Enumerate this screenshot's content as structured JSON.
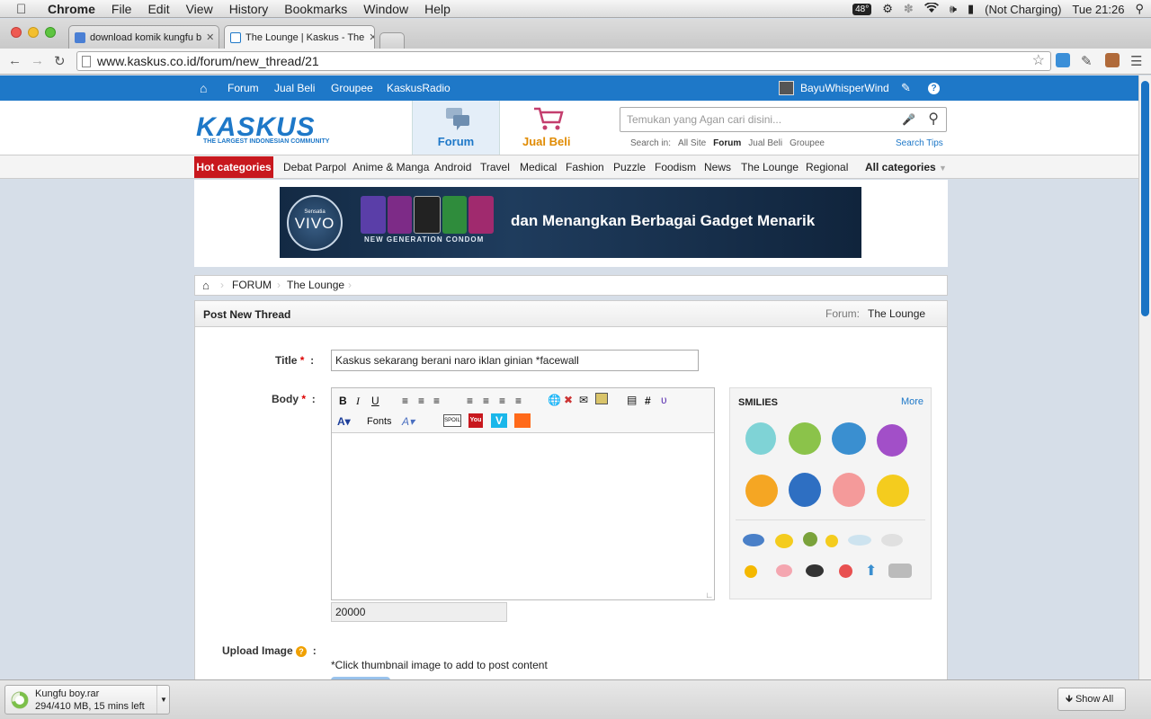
{
  "menubar": {
    "app_name": "Chrome",
    "items": [
      "File",
      "Edit",
      "View",
      "History",
      "Bookmarks",
      "Window",
      "Help"
    ],
    "temperature": "48°",
    "battery_status": "(Not Charging)",
    "clock": "Tue 21:26"
  },
  "tabs": [
    {
      "title": "download komik kungfu b"
    },
    {
      "title": "The Lounge | Kaskus - The"
    }
  ],
  "toolbar": {
    "url": "www.kaskus.co.id/forum/new_thread/21"
  },
  "site_nav": {
    "items": [
      "Forum",
      "Jual Beli",
      "Groupee",
      "KaskusRadio"
    ],
    "username": "BayuWhisperWind"
  },
  "header": {
    "logo_text": "KASKUS",
    "logo_tagline": "THE LARGEST INDONESIAN COMMUNITY",
    "forum_tab": "Forum",
    "jualbeli_tab": "Jual Beli",
    "search_placeholder": "Temukan yang Agan cari disini...",
    "search_in_label": "Search in:",
    "search_scopes": [
      "All Site",
      "Forum",
      "Jual Beli",
      "Groupee"
    ],
    "search_tips": "Search Tips"
  },
  "categories": {
    "hot_label": "Hot categories",
    "items": [
      "Debat Parpol",
      "Anime & Manga",
      "Android",
      "Travel",
      "Medical",
      "Fashion",
      "Puzzle",
      "Foodism",
      "News",
      "The Lounge",
      "Regional"
    ],
    "all_label": "All categories"
  },
  "banner": {
    "brand_top": "Sensatia",
    "brand": "VIVO",
    "tagline": "NEW GENERATION CONDOM",
    "headline": "dan Menangkan Berbagai Gadget Menarik"
  },
  "breadcrumb": {
    "items": [
      "FORUM",
      "The Lounge"
    ]
  },
  "post_form": {
    "heading": "Post New Thread",
    "forum_label": "Forum:",
    "forum_name": "The Lounge",
    "title_label": "Title",
    "title_value": "Kaskus sekarang berani naro iklan ginian *facewall",
    "body_label": "Body",
    "fonts_label": "Fonts",
    "char_counter": "20000",
    "smilies_label": "SMILIES",
    "smilies_more": "More",
    "upload_label": "Upload Image",
    "upload_hint": "*Click thumbnail image to add to post content",
    "required_mark": "*",
    "colon": ":"
  },
  "downloads": {
    "file_name": "Kungfu boy.rar",
    "progress_text": "294/410 MB, 15 mins left",
    "progress_fraction": 0.717,
    "show_all": "Show All"
  },
  "colors": {
    "kaskus_blue": "#1e78c8",
    "hot_red": "#c8181e",
    "jualbeli_orange": "#e08a00"
  }
}
